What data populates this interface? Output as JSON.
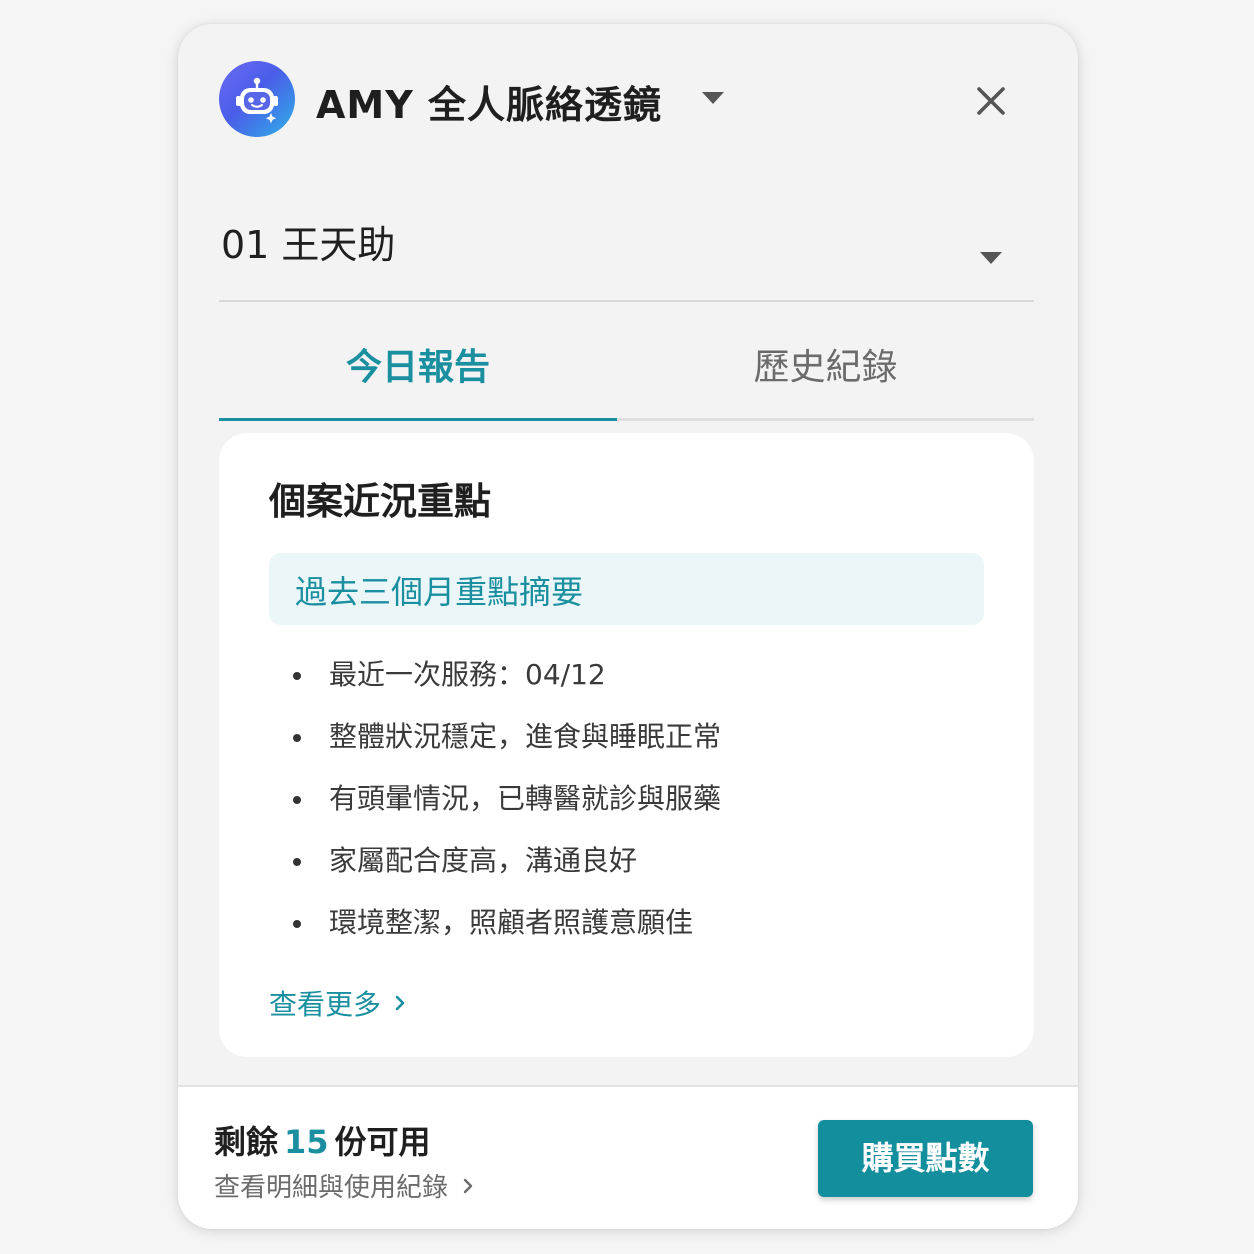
{
  "header": {
    "app_title": "AMY 全人脈絡透鏡",
    "avatar_icon": "robot-icon",
    "close_icon": "close-icon"
  },
  "client_selector": {
    "selected": "01 王天助"
  },
  "tabs": [
    {
      "label": "今日報告",
      "active": true
    },
    {
      "label": "歷史紀錄",
      "active": false
    }
  ],
  "card": {
    "title": "個案近況重點",
    "summary_label": "過去三個月重點摘要",
    "items": [
      "最近一次服務：04/12",
      "整體狀況穩定，進食與睡眠正常",
      "有頭暈情況，已轉醫就診與服藥",
      "家屬配合度高，溝通良好",
      "環境整潔，照顧者照護意願佳"
    ],
    "see_more": "查看更多"
  },
  "footer": {
    "remaining_prefix": "剩餘",
    "remaining_count": "15",
    "remaining_suffix": "份可用",
    "detail_link": "查看明細與使用紀錄",
    "buy_button": "購買點數"
  },
  "colors": {
    "accent": "#1a8fa0",
    "button": "#138e9c",
    "summary_bg": "#eaf6f8"
  }
}
